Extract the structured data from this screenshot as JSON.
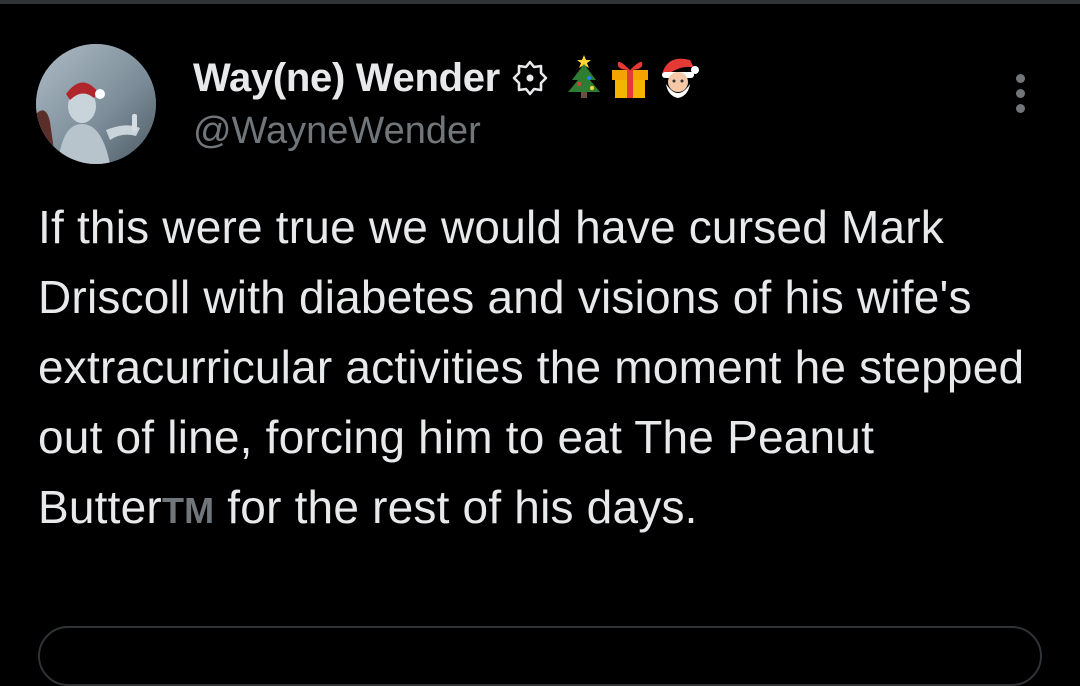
{
  "tweet": {
    "author": {
      "display_name": "Way(ne) Wender",
      "handle": "@WayneWender",
      "badge_icon": "gear-badge-icon",
      "name_emojis": [
        "🎄",
        "🎁",
        "🎅"
      ]
    },
    "text_before_tm": "If this were true we would have cursed Mark Driscoll with diabetes and visions of his wife's extracurricular activities the moment he stepped out of line, forcing him to eat The Peanut Butter",
    "tm_mark": "TM",
    "text_after_tm": " for the rest of his days.",
    "more_icon": "more-vertical-icon"
  },
  "colors": {
    "background": "#000000",
    "text_primary": "#e7e9ea",
    "text_secondary": "#71767b",
    "border": "#2f3336"
  }
}
